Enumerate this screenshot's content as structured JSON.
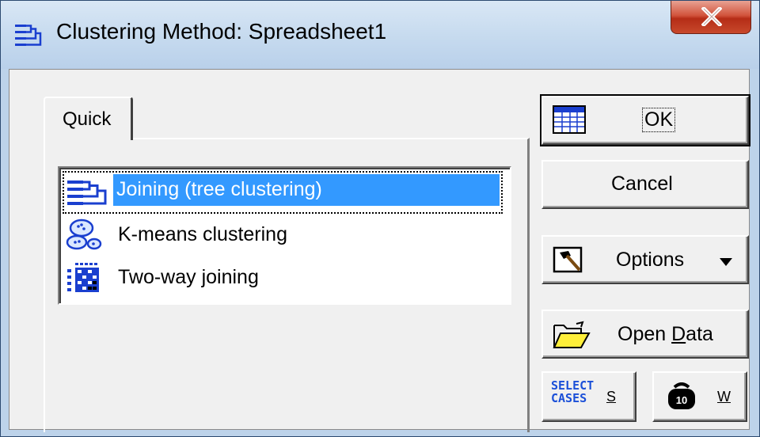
{
  "window": {
    "title": "Clustering Method: Spreadsheet1",
    "close_glyph": "X"
  },
  "tabs": [
    {
      "label": "Quick",
      "active": true
    }
  ],
  "methods": [
    {
      "label": "Joining (tree clustering)",
      "icon": "tree-clustering-icon",
      "selected": true
    },
    {
      "label": "K-means clustering",
      "icon": "k-means-icon",
      "selected": false
    },
    {
      "label": "Two-way joining",
      "icon": "two-way-joining-icon",
      "selected": false
    }
  ],
  "buttons": {
    "ok": "OK",
    "cancel": "Cancel",
    "options": "Options",
    "open_data_prefix": "Open ",
    "open_data_accel": "D",
    "open_data_suffix": "ata",
    "select_cases_top": "SELECT",
    "select_cases_bottom": "CASES",
    "select_cases_key": "S",
    "weight_key": "W",
    "weight_icon_text": "10"
  },
  "colors": {
    "selection": "#3399ff",
    "close_button": "#c8482b",
    "select_cases_text": "#1a4fd8"
  }
}
